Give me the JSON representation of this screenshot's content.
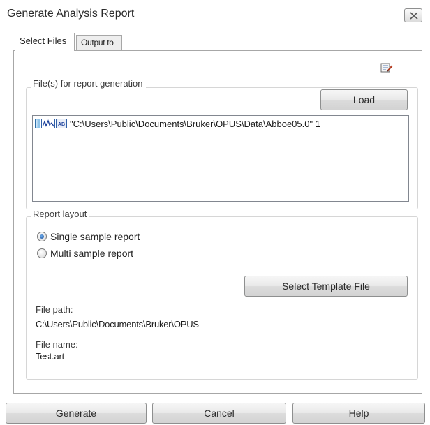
{
  "window": {
    "title": "Generate Analysis Report",
    "close_icon": "close-icon"
  },
  "tabs": [
    {
      "label": "Select Files",
      "active": true
    },
    {
      "label": "Output to",
      "active": false
    }
  ],
  "files_group": {
    "legend": "File(s) for report generation",
    "load_button": "Load",
    "items": [
      {
        "text": "\"C:\\Users\\Public\\Documents\\Bruker\\OPUS\\Data\\Abboe05.0\" 1",
        "icons": [
          "file-icon",
          "spectrum-icon",
          "ab-block-icon"
        ]
      }
    ]
  },
  "layout_group": {
    "legend": "Report layout",
    "options": [
      {
        "label": "Single sample report",
        "checked": true
      },
      {
        "label": "Multi sample report",
        "checked": false
      }
    ],
    "template_button": "Select Template File",
    "file_path_label": "File path:",
    "file_path_value": "C:\\Users\\Public\\Documents\\Bruker\\OPUS",
    "file_name_label": "File name:",
    "file_name_value": "Test.art"
  },
  "footer": {
    "generate": "Generate",
    "cancel": "Cancel",
    "help": "Help"
  }
}
